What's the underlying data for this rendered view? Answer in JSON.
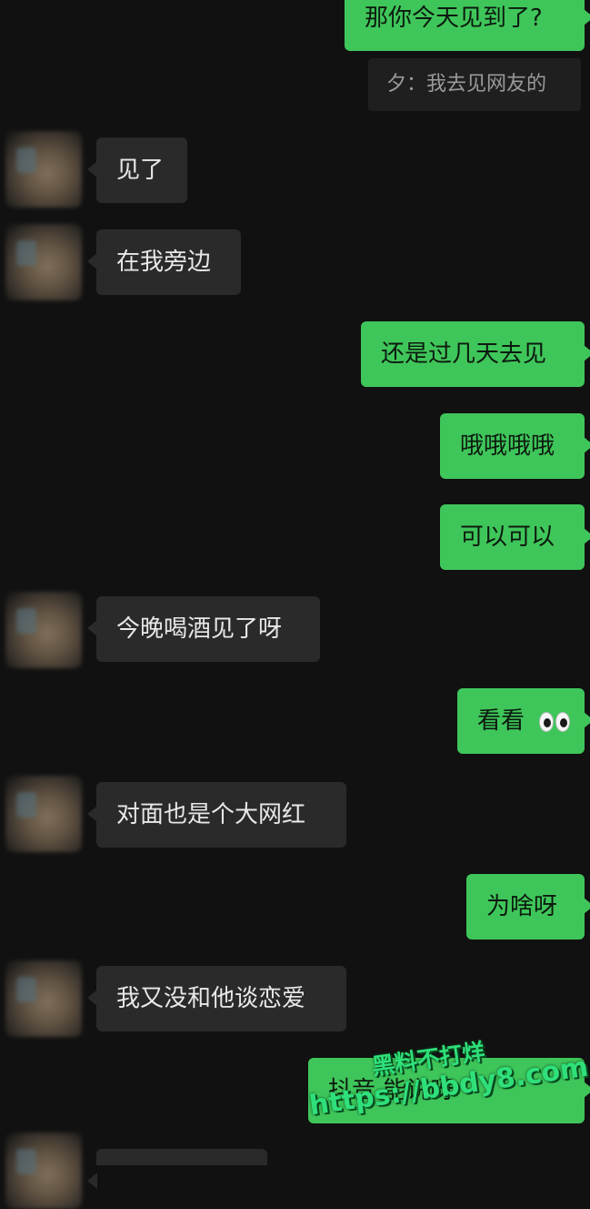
{
  "messages": [
    {
      "side": "me",
      "text": "那你今天见到了?"
    },
    {
      "side": "quote",
      "text": "夕：我去见网友的"
    },
    {
      "side": "them",
      "text": "见了"
    },
    {
      "side": "them",
      "text": "在我旁边"
    },
    {
      "side": "me",
      "text": "还是过几天去见"
    },
    {
      "side": "me",
      "text": "哦哦哦哦"
    },
    {
      "side": "me",
      "text": "可以可以"
    },
    {
      "side": "them",
      "text": "今晚喝酒见了呀"
    },
    {
      "side": "me",
      "text": "看看",
      "emoji": "eyes-emoji"
    },
    {
      "side": "them",
      "text": "对面也是个大网红"
    },
    {
      "side": "me",
      "text": "为啥呀"
    },
    {
      "side": "them",
      "text": "我又没和他谈恋爱"
    },
    {
      "side": "me",
      "text": "抖音  能说呀"
    }
  ],
  "watermark": {
    "line1": "黑料不打烊",
    "line2": "https://bbdy8.com"
  },
  "colors": {
    "background": "#111111",
    "my_bubble": "#3fc65a",
    "their_bubble": "#2a2a2a",
    "watermark": "#2fe07a"
  }
}
